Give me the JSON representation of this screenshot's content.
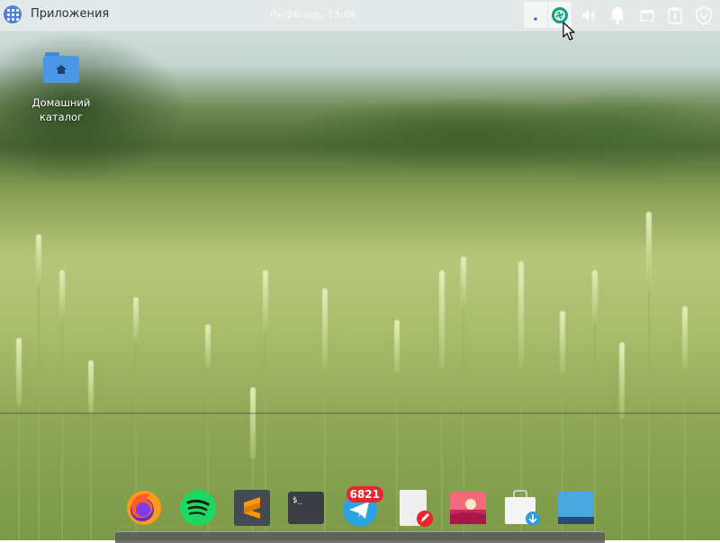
{
  "panel": {
    "apps_label": "Приложения",
    "clock": "Пн 26 апр, 15:06"
  },
  "tray": {
    "icons": [
      "keyboard-layout-icon",
      "screenshot-icon",
      "volume-icon",
      "notifications-bell-icon",
      "window-icon",
      "clipboard-icon",
      "shield-icon"
    ]
  },
  "desktop": {
    "home_folder_line1": "Домашний",
    "home_folder_line2": "каталог"
  },
  "dock": {
    "apps": [
      "firefox",
      "spotify",
      "sublime-text",
      "terminal",
      "telegram",
      "text-editor",
      "image-viewer",
      "software-installer",
      "files"
    ],
    "telegram_badge": "6821",
    "terminal_prompt": "$_"
  },
  "colors": {
    "accent": "#4f7fd8",
    "folder": "#4a98e6",
    "badge": "#e8242c"
  }
}
